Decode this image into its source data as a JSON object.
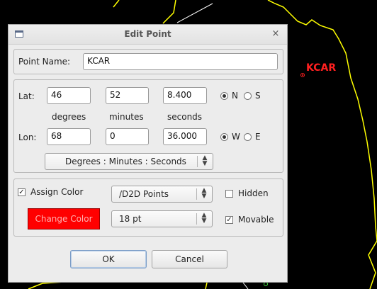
{
  "map": {
    "point_label": "KCAR",
    "colors": {
      "background": "#000000",
      "boundary": "#ffff00",
      "point": "#ff2020",
      "border": "#ffffff"
    }
  },
  "dialog": {
    "title": "Edit Point",
    "close_glyph": "×",
    "point_name_label": "Point Name:",
    "point_name_value": "KCAR",
    "lat": {
      "label": "Lat:",
      "degrees": "46",
      "minutes": "52",
      "seconds": "8.400",
      "option_n": "N",
      "option_s": "S",
      "selected": "N"
    },
    "units_labels": {
      "degrees": "degrees",
      "minutes": "minutes",
      "seconds": "seconds"
    },
    "lon": {
      "label": "Lon:",
      "degrees": "68",
      "minutes": "0",
      "seconds": "36.000",
      "option_w": "W",
      "option_e": "E",
      "selected": "W"
    },
    "format_select": "Degrees : Minutes : Seconds",
    "assign_color": {
      "label": "Assign Color",
      "checked": true
    },
    "change_color_label": "Change Color",
    "change_color_color": "#ff0000",
    "group_select": "/D2D Points",
    "size_select": "18 pt",
    "hidden": {
      "label": "Hidden",
      "checked": false
    },
    "movable": {
      "label": "Movable",
      "checked": true
    },
    "ok_label": "OK",
    "cancel_label": "Cancel"
  }
}
